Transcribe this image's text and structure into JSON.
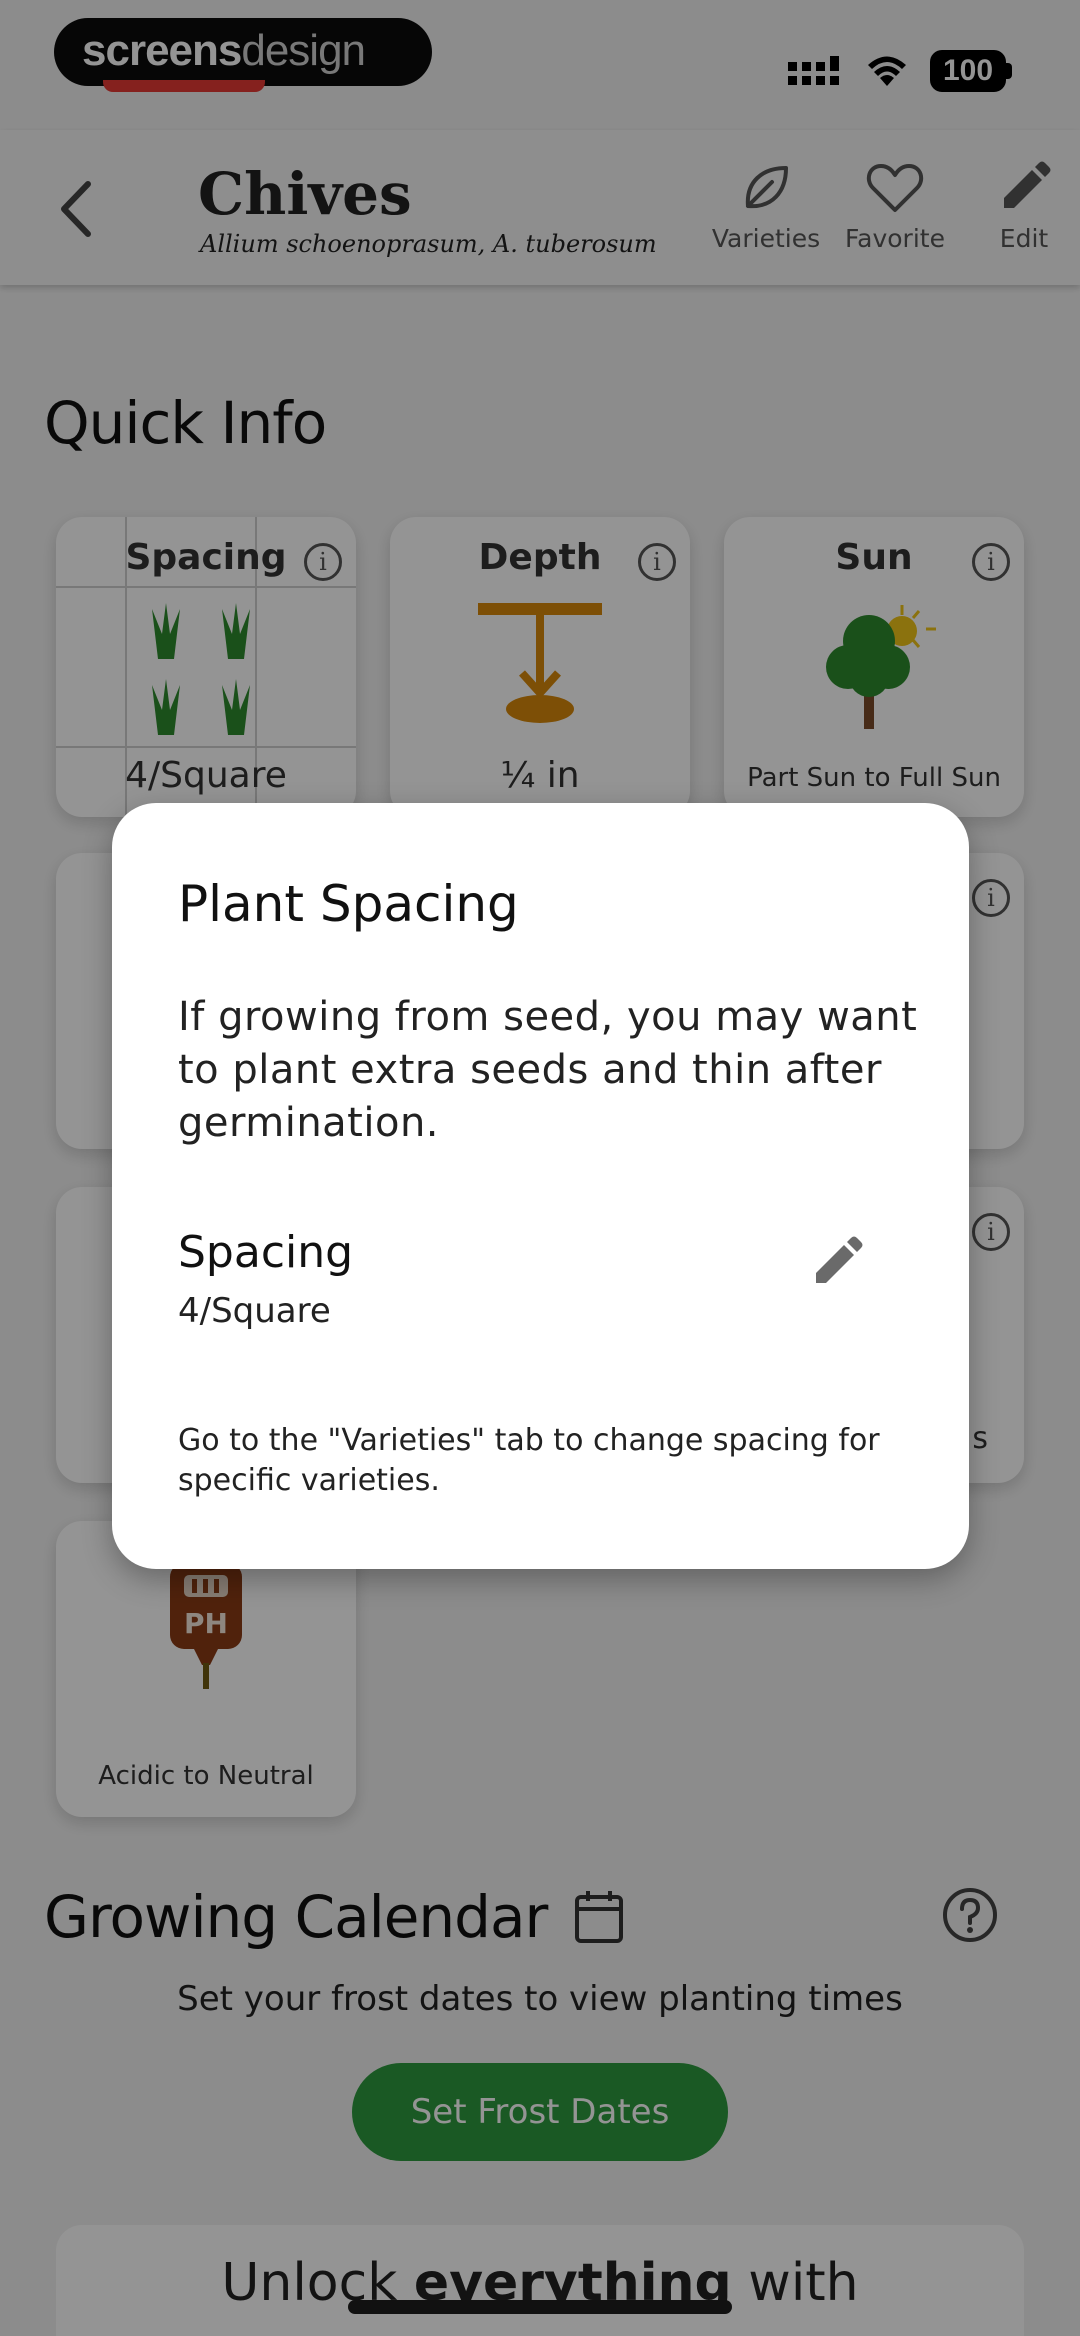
{
  "status_bar": {
    "brand_part1": "screens",
    "brand_part2": "design",
    "battery": "100"
  },
  "header": {
    "title": "Chives",
    "scientific_name": "Allium schoenoprasum, A. tuberosum",
    "actions": [
      {
        "label": "Varieties",
        "icon": "leaf-icon"
      },
      {
        "label": "Favorite",
        "icon": "heart-icon"
      },
      {
        "label": "Edit",
        "icon": "pencil-icon"
      }
    ]
  },
  "quick_info": {
    "title": "Quick Info",
    "cards": [
      {
        "title": "Spacing",
        "value": "4/Square",
        "icon": "grass-grid-icon"
      },
      {
        "title": "Depth",
        "value": "¼ in",
        "icon": "seed-depth-icon"
      },
      {
        "title": "Sun",
        "value": "Part Sun to Full Sun",
        "icon": "tree-sun-icon"
      },
      {
        "title": "pH",
        "value": "Acidic to Neutral",
        "icon": "ph-meter-icon"
      },
      {
        "partial_value": "s"
      }
    ]
  },
  "calendar": {
    "title": "Growing Calendar",
    "message": "Set your frost dates to view planting times",
    "button": "Set Frost Dates"
  },
  "bottom_banner": {
    "pre": "Unlock ",
    "emphasis": "everything",
    "post": " with"
  },
  "dialog": {
    "title": "Plant Spacing",
    "body": "If growing from seed, you may want to plant extra seeds and thin after germination.",
    "field_label": "Spacing",
    "field_value": "4/Square",
    "note": "Go to the \"Varieties\" tab to change spacing for specific varieties."
  },
  "colors": {
    "accent_green": "#2e9a3e",
    "depth_orange": "#d7890b",
    "ph_brown": "#8a3b15"
  }
}
